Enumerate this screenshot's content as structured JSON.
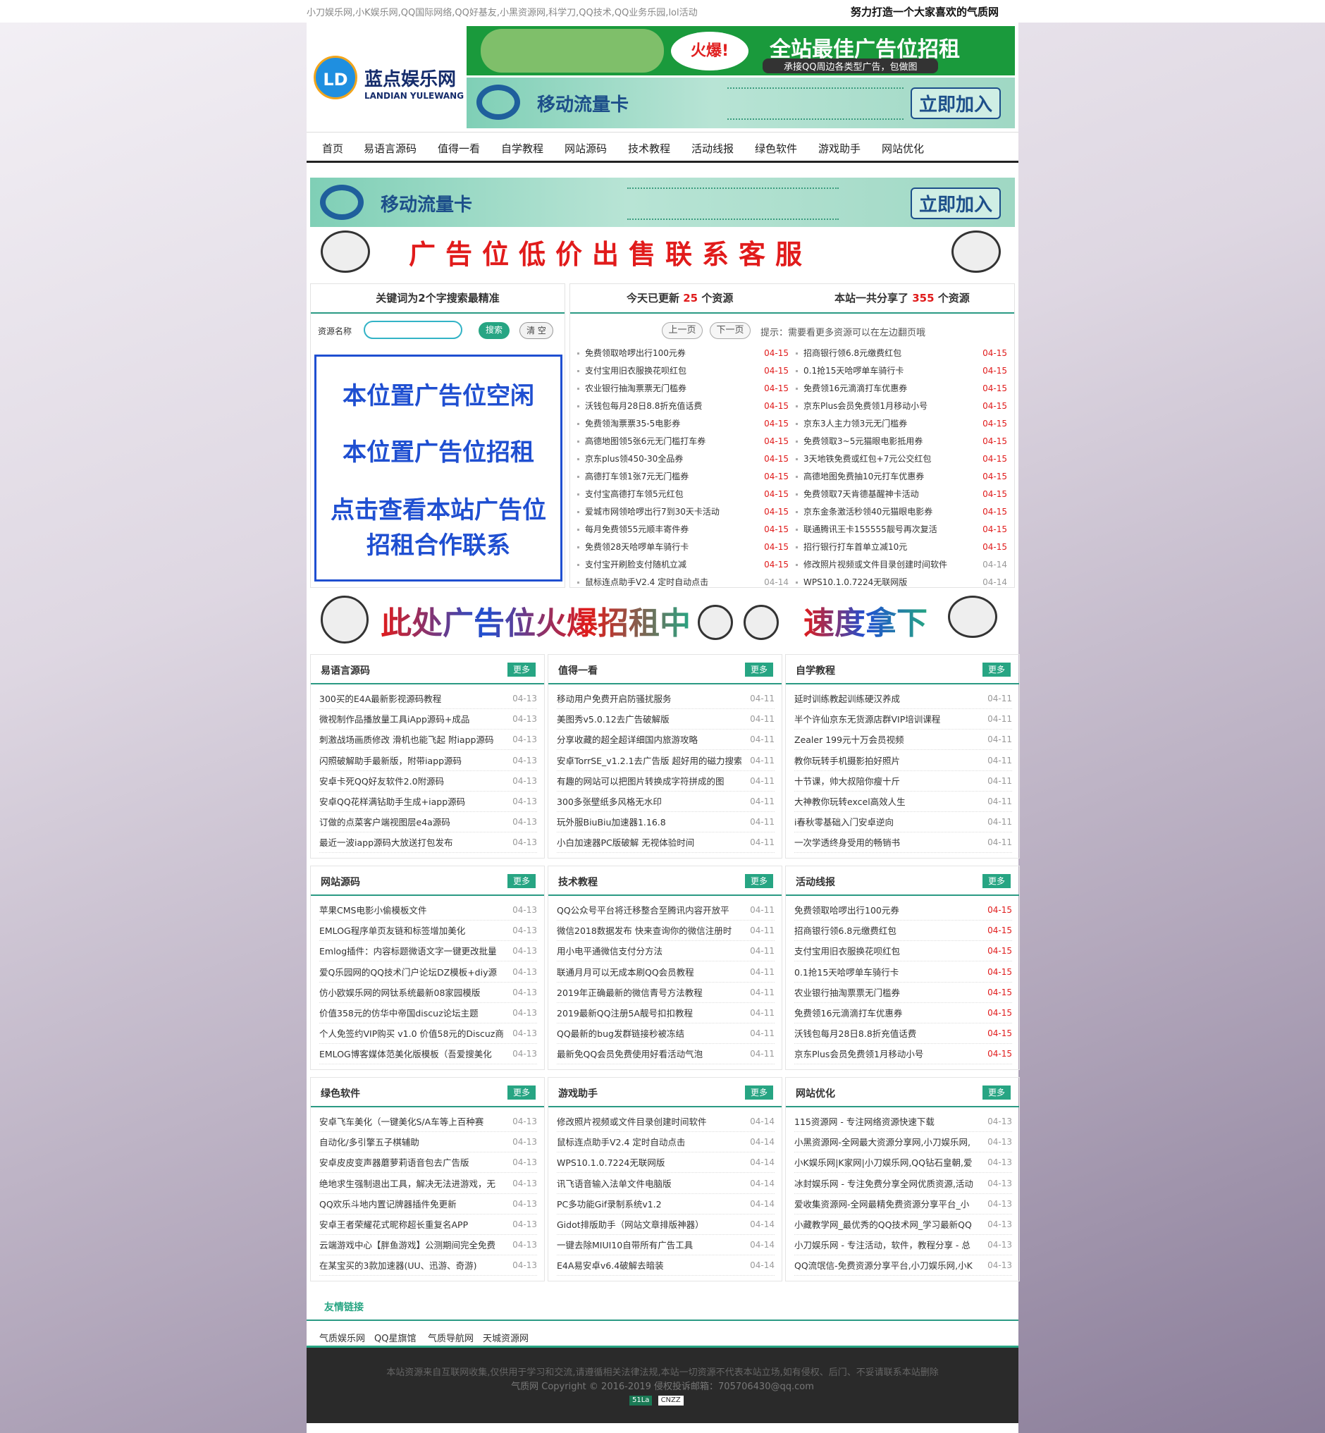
{
  "top": {
    "keywords": "小刀娱乐网,小K娱乐网,QQ国际网络,QQ好基友,小黑资源网,科学刀,QQ技术,QQ业务乐园,lol活动",
    "slogan": "努力打造一个大家喜欢的气质网"
  },
  "logo": {
    "mark": "LD",
    "name": "蓝点娱乐网",
    "en": "LANDIAN YULEWANG"
  },
  "banners": {
    "b1_hot": "火爆!",
    "b1_title": "全站最佳广告位招租",
    "b1_sub": "承接QQ周边各类型广告，包做图",
    "card_title": "移动流量卡",
    "card_join": "立即加入",
    "cheap_ad": "广告位低价出售联系客服",
    "hot_ad_a": "此处广告位火爆招租中",
    "hot_ad_b": "速度拿下"
  },
  "nav": [
    "首页",
    "易语言源码",
    "值得一看",
    "自学教程",
    "网站源码",
    "技术教程",
    "活动线报",
    "绿色软件",
    "游戏助手",
    "网站优化"
  ],
  "search": {
    "title": "关键词为2个字搜索最精准",
    "label": "资源名称",
    "value": "",
    "search_btn": "搜索",
    "clear_btn": "清 空"
  },
  "adbox": {
    "line1": "本位置广告位空闲",
    "line2": "本位置广告位招租",
    "line3": "点击查看本站广告位",
    "line4": "招租合作联系"
  },
  "stats": {
    "today_prefix": "今天已更新",
    "today_count": "25",
    "today_suffix": "个资源",
    "total_prefix": "本站一共分享了",
    "total_count": "355",
    "total_suffix": "个资源",
    "prev": "上一页",
    "next": "下一页",
    "tip": "提示：需要看更多资源可以在左边翻页哦"
  },
  "updates_left": [
    [
      "免费领取哈啰出行100元券",
      "04-15"
    ],
    [
      "支付宝用旧衣服换花呗红包",
      "04-15"
    ],
    [
      "农业银行抽淘票票无门槛券",
      "04-15"
    ],
    [
      "沃钱包每月28日8.8折充值话费",
      "04-15"
    ],
    [
      "免费领淘票票35-5电影券",
      "04-15"
    ],
    [
      "高德地图领5张6元无门槛打车券",
      "04-15"
    ],
    [
      "京东plus领450-30全品券",
      "04-15"
    ],
    [
      "高德打车领1张7元无门槛券",
      "04-15"
    ],
    [
      "支付宝高德打车领5元红包",
      "04-15"
    ],
    [
      "爱城市网领哈啰出行7到30天卡活动",
      "04-15"
    ],
    [
      "每月免费领55元顺丰寄件券",
      "04-15"
    ],
    [
      "免费领28天哈啰单车骑行卡",
      "04-15"
    ],
    [
      "支付宝开刷脸支付随机立减",
      "04-15"
    ],
    [
      "鼠标连点助手V2.4 定时自动点击",
      "04-14"
    ]
  ],
  "updates_right": [
    [
      "招商银行领6.8元缴费红包",
      "04-15"
    ],
    [
      "0.1抢15天哈啰单车骑行卡",
      "04-15"
    ],
    [
      "免费领16元滴滴打车优惠券",
      "04-15"
    ],
    [
      "京东Plus会员免费领1月移动小号",
      "04-15"
    ],
    [
      "京东3人主力领3元无门槛券",
      "04-15"
    ],
    [
      "免费领取3~5元猫眼电影抵用券",
      "04-15"
    ],
    [
      "3天地铁免费或红包+7元公交红包",
      "04-15"
    ],
    [
      "高德地图免费抽10元打车优惠券",
      "04-15"
    ],
    [
      "免费领取7天肯德基醒神卡活动",
      "04-15"
    ],
    [
      "京东金条激活秒领40元猫眼电影券",
      "04-15"
    ],
    [
      "联通腾讯王卡155555靓号再次复活",
      "04-15"
    ],
    [
      "招行银行打车首单立减10元",
      "04-15"
    ],
    [
      "修改照片视频或文件目录创建时间软件",
      "04-14"
    ],
    [
      "WPS10.1.0.7224无联网版",
      "04-14"
    ]
  ],
  "more_label": "更多",
  "categories": [
    {
      "title": "易语言源码",
      "items": [
        [
          "300买的E4A最新影视源码教程",
          "04-13"
        ],
        [
          "微视制作品播放量工具iApp源码+成品",
          "04-13"
        ],
        [
          "刺激战场画质修改 滑机也能飞起 附iapp源码",
          "04-13"
        ],
        [
          "闪照破解助手最新版，附带iapp源码",
          "04-13"
        ],
        [
          "安卓卡死QQ好友软件2.0附源码",
          "04-13"
        ],
        [
          "安卓QQ花样满钻助手生成+iapp源码",
          "04-13"
        ],
        [
          "订做的点菜客户端视图层e4a源码",
          "04-13"
        ],
        [
          "最近一波iapp源码大放送打包发布",
          "04-13"
        ]
      ]
    },
    {
      "title": "值得一看",
      "items": [
        [
          "移动用户免费开启防骚扰服务",
          "04-11"
        ],
        [
          "美图秀v5.0.12去广告破解版",
          "04-11"
        ],
        [
          "分享收藏的超全超详细国内旅游攻略",
          "04-11"
        ],
        [
          "安卓TorrSE_v1.2.1去广告版 超好用的磁力搜索",
          "04-11"
        ],
        [
          "有趣的网站可以把图片转换成字符拼成的图",
          "04-11"
        ],
        [
          "300多张壁纸多风格无水印",
          "04-11"
        ],
        [
          "玩外服BiuBiu加速器1.16.8",
          "04-11"
        ],
        [
          "小白加速器PC版破解 无视体验时间",
          "04-11"
        ]
      ]
    },
    {
      "title": "自学教程",
      "items": [
        [
          "延时训练教起训练硬汉养成",
          "04-11"
        ],
        [
          "半个许仙京东无货源店群VIP培训课程",
          "04-11"
        ],
        [
          "Zealer 199元十万会员视频",
          "04-11"
        ],
        [
          "教你玩转手机摄影拍好照片",
          "04-11"
        ],
        [
          "十节课，帅大叔陪你瘦十斤",
          "04-11"
        ],
        [
          "大神教你玩转excel高效人生",
          "04-11"
        ],
        [
          "i春秋零基础入门安卓逆向",
          "04-11"
        ],
        [
          "一次学透终身受用的畅销书",
          "04-11"
        ]
      ]
    },
    {
      "title": "网站源码",
      "items": [
        [
          "苹果CMS电影小偷模板文件",
          "04-13"
        ],
        [
          "EMLOG程序单页友链和标签增加美化",
          "04-13"
        ],
        [
          "Emlog插件：内容标题微语文字一键更改批量",
          "04-13"
        ],
        [
          "爱Q乐园网的QQ技术门户论坛DZ模板+diy源",
          "04-13"
        ],
        [
          "仿小欧娱乐网的网钛系统最新08家园模版",
          "04-13"
        ],
        [
          "价值358元的仿华中帝国discuz论坛主题",
          "04-13"
        ],
        [
          "个人免签约VIP购买 v1.0 价值58元的Discuz商",
          "04-13"
        ],
        [
          "EMLOG博客媒体范美化版模板（吾爱搜美化",
          "04-13"
        ]
      ]
    },
    {
      "title": "技术教程",
      "items": [
        [
          "QQ公众号平台将迁移整合至腾讯内容开放平",
          "04-11"
        ],
        [
          "微信2018数据发布 快来查询你的微信注册时",
          "04-11"
        ],
        [
          "用小电平通微信支付分方法",
          "04-11"
        ],
        [
          "联通月月可以无成本刷QQ会员教程",
          "04-11"
        ],
        [
          "2019年正确最新的微信青号方法教程",
          "04-11"
        ],
        [
          "2019最新QQ注册5A靓号扣扣教程",
          "04-11"
        ],
        [
          "QQ最新的bug发群链接秒被冻结",
          "04-11"
        ],
        [
          "最新免QQ会员免费使用好看活动气泡",
          "04-11"
        ]
      ]
    },
    {
      "title": "活动线报",
      "items": [
        [
          "免费领取哈啰出行100元券",
          "04-15"
        ],
        [
          "招商银行领6.8元缴费红包",
          "04-15"
        ],
        [
          "支付宝用旧衣服换花呗红包",
          "04-15"
        ],
        [
          "0.1抢15天哈啰单车骑行卡",
          "04-15"
        ],
        [
          "农业银行抽淘票票无门槛券",
          "04-15"
        ],
        [
          "免费领16元滴滴打车优惠券",
          "04-15"
        ],
        [
          "沃钱包每月28日8.8折充值话费",
          "04-15"
        ],
        [
          "京东Plus会员免费领1月移动小号",
          "04-15"
        ]
      ]
    },
    {
      "title": "绿色软件",
      "items": [
        [
          "安卓飞车美化（一键美化S/A车等上百种赛",
          "04-13"
        ],
        [
          "自动化/多引擎五子棋辅助",
          "04-13"
        ],
        [
          "安卓皮皮变声器蘑萝莉语音包去广告版",
          "04-13"
        ],
        [
          "绝地求生强制退出工具，解决无法进游戏，无",
          "04-13"
        ],
        [
          "QQ欢乐斗地内置记牌器插件免更新",
          "04-13"
        ],
        [
          "安卓王者荣耀花式昵称超长重复名APP",
          "04-13"
        ],
        [
          "云端游戏中心【胖鱼游戏】公测期间完全免费",
          "04-13"
        ],
        [
          "在某宝买的3款加速器(UU、迅游、奇游)",
          "04-13"
        ]
      ]
    },
    {
      "title": "游戏助手",
      "items": [
        [
          "修改照片视频或文件目录创建时间软件",
          "04-14"
        ],
        [
          "鼠标连点助手V2.4 定时自动点击",
          "04-14"
        ],
        [
          "WPS10.1.0.7224无联网版",
          "04-14"
        ],
        [
          "讯飞语音输入法单文件电脑版",
          "04-14"
        ],
        [
          "PC多功能Gif录制系统v1.2",
          "04-14"
        ],
        [
          "Gidot排版助手（网站文章排版神器）",
          "04-14"
        ],
        [
          "一键去除MIUI10自带所有广告工具",
          "04-14"
        ],
        [
          "E4A易安卓v6.4破解去暗装",
          "04-14"
        ]
      ]
    },
    {
      "title": "网站优化",
      "items": [
        [
          "115资源网 - 专注网络资源快速下载",
          "04-13"
        ],
        [
          "小黑资源网-全网最大资源分享网,小刀娱乐网,",
          "04-13"
        ],
        [
          "小K娱乐网|K家网|小刀娱乐网,QQ钻石皇朝,爱",
          "04-13"
        ],
        [
          "冰封娱乐网 - 专注免费分享全网优质资源,活动",
          "04-13"
        ],
        [
          "爱收集资源网-全网最精免费资源分享平台_小",
          "04-13"
        ],
        [
          "小藏教学网_最优秀的QQ技术网_学习最新QQ",
          "04-13"
        ],
        [
          "小刀娱乐网 - 专注活动，软件，教程分享 - 总",
          "04-13"
        ],
        [
          "QQ流氓信-免费资源分享平台,小刀娱乐网,小K",
          "04-13"
        ]
      ]
    }
  ],
  "friend_links": {
    "title": "友情链接",
    "items": [
      "气质娱乐网",
      "QQ星旗馆",
      "气质导航网",
      "天城资源网"
    ]
  },
  "footer": {
    "line1": "本站资源来自互联网收集,仅供用于学习和交流,请遵循相关法律法规,本站一切资源不代表本站立场,如有侵权、后门、不妥请联系本站删除",
    "line2": "气质网 Copyright © 2016-2019 侵权投诉邮箱：705706430@qq.com",
    "badge1": "51La",
    "badge2": "CNZZ"
  },
  "colors": {
    "accent": "#27a583",
    "red": "#e01b1b",
    "ad_blue": "#1f4fd1"
  }
}
